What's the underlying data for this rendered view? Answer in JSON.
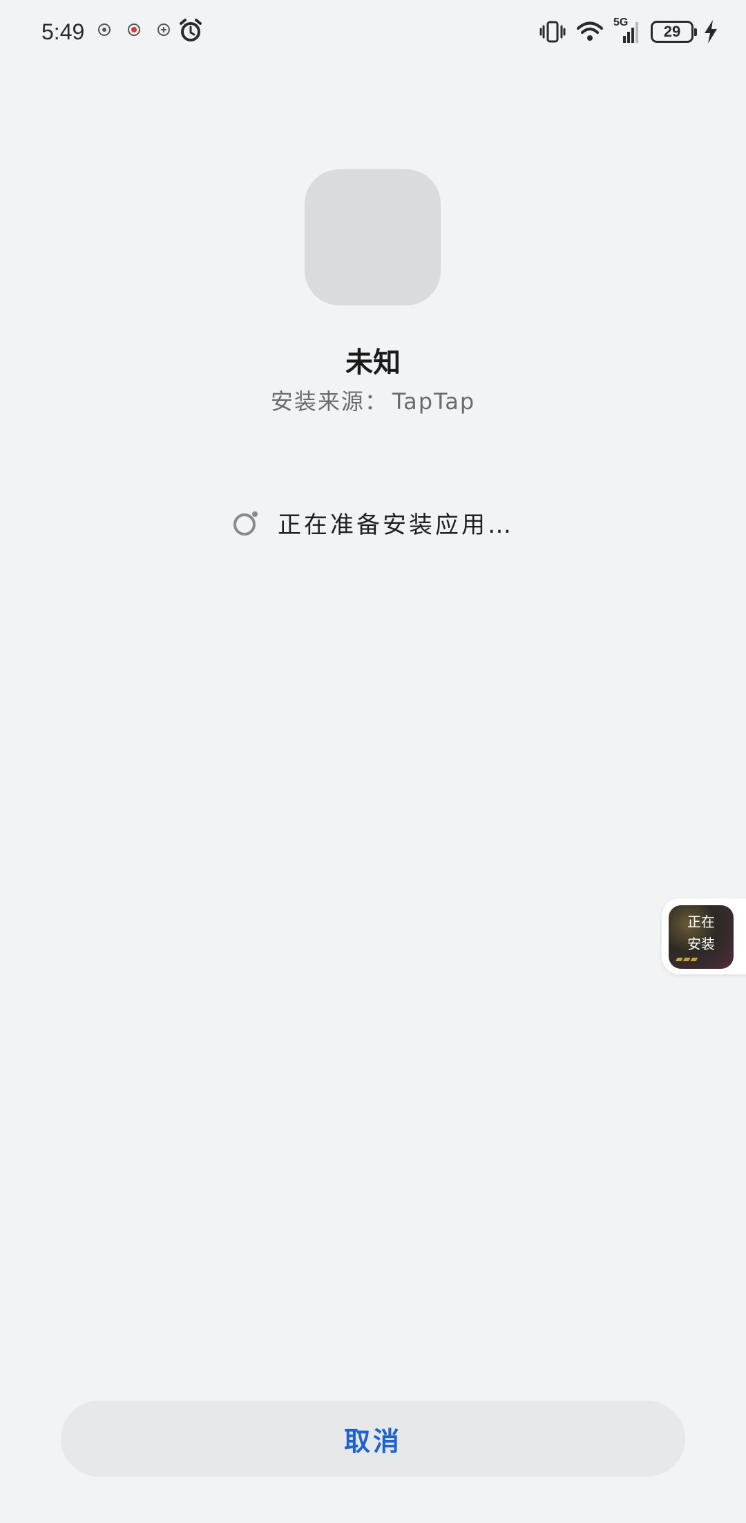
{
  "status_bar": {
    "time": "5:49",
    "battery_level": "29",
    "network": "5G",
    "icons": [
      "notification-icon-1",
      "notification-icon-2",
      "notification-icon-3",
      "alarm-icon",
      "vibrate-icon",
      "wifi-icon",
      "signal-icon",
      "battery-icon",
      "charging-icon"
    ]
  },
  "app": {
    "name": "未知",
    "source_label": "安装来源：",
    "source_value": "TapTap"
  },
  "progress": {
    "text": "正在准备安装应用…"
  },
  "floating_badge": {
    "line1": "正在",
    "line2": "安装"
  },
  "actions": {
    "cancel_label": "取消"
  },
  "colors": {
    "background": "#f2f3f5",
    "accent": "#1a62d6",
    "button_bg": "#e7e8ea"
  }
}
